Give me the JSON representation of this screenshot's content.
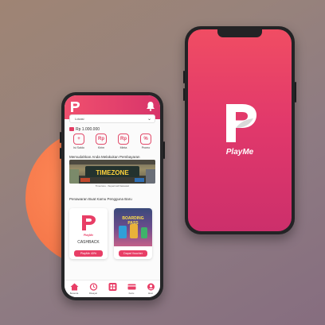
{
  "colors": {
    "brand_primary": "#f0506e",
    "brand_dark": "#cc2f6b",
    "accent_orange": "#f67a4c"
  },
  "home_screen": {
    "location_label": "Lokasi",
    "balance": "Rp 1.000.000",
    "quick_actions": [
      {
        "label": "Isi Saldo",
        "icon": "plus-icon"
      },
      {
        "label": "Kirim",
        "icon": "send-money-icon"
      },
      {
        "label": "Minta",
        "icon": "request-money-icon"
      },
      {
        "label": "Promo",
        "icon": "percent-icon"
      }
    ],
    "section1_title": "Memudahkan Anda Melakukan Pembayaran",
    "banner_text": "TIMEZONE",
    "banner_caption": "Timezone - Supermall Karawaci",
    "section2_title": "Penawaran Buat Kamu Pengguna Baru",
    "promo_cards": [
      {
        "logo_text": "PlayMe",
        "title": "CASHBACK",
        "button": "PlayMe 40%"
      },
      {
        "image_text": "BOARDING PASS",
        "button": "Dapat Voucher"
      }
    ],
    "bottom_nav": [
      "Beranda",
      "Riwayat",
      "",
      "Kartu",
      "Akun"
    ]
  },
  "splash_screen": {
    "brand_name": "PlayMe"
  }
}
